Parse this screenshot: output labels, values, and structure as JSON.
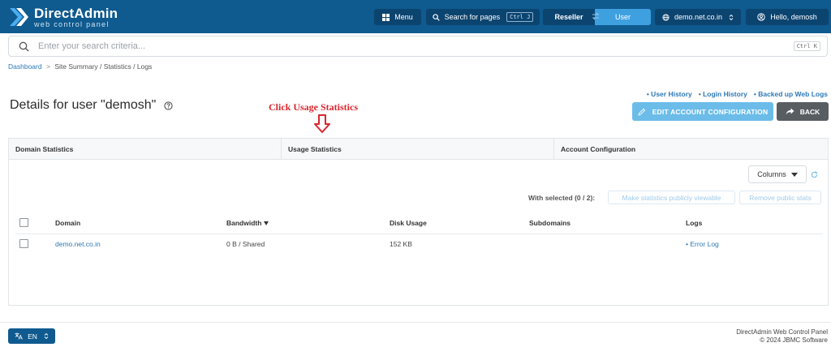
{
  "header": {
    "logo_title": "DirectAdmin",
    "logo_subtitle": "web control panel",
    "menu_label": "Menu",
    "search_pages_label": "Search for pages",
    "search_pages_shortcut": "Ctrl J",
    "role_reseller": "Reseller",
    "role_user": "User",
    "domain_selector": "demo.net.co.in",
    "hello_label": "Hello, demosh"
  },
  "search": {
    "placeholder": "Enter your search criteria...",
    "shortcut": "Ctrl K"
  },
  "breadcrumb": {
    "home": "Dashboard",
    "separator": ">",
    "current": "Site Summary / Statistics / Logs"
  },
  "user_links": [
    "• User History",
    "• Login History",
    "• Backed up Web Logs"
  ],
  "page_title": "Details for user \"demosh\"",
  "annotation": {
    "text": "Click Usage Statistics",
    "color": "#d9262e"
  },
  "actions": {
    "edit_label": "EDIT ACCOUNT CONFIGURATION",
    "back_label": "BACK"
  },
  "tabs": [
    "Domain Statistics",
    "Usage Statistics",
    "Account Configuration"
  ],
  "table_tools": {
    "columns_label": "Columns",
    "with_selected": "With selected (0 / 2):",
    "make_public_label": "Make statistics publicly viewable",
    "remove_public_label": "Remove public stats"
  },
  "table": {
    "headers": [
      "Domain",
      "Bandwidth",
      "Disk Usage",
      "Subdomains",
      "Logs"
    ],
    "rows": [
      {
        "domain": "demo.net.co.in",
        "bandwidth": "0 B / Shared",
        "disk_usage": "152 KB",
        "subdomains": "",
        "logs": "• Error Log"
      }
    ]
  },
  "footer": {
    "lang_label": "EN",
    "product": "DirectAdmin Web Control Panel",
    "copyright": "© 2024 JBMC Software"
  },
  "colors": {
    "header_bg": "#0f5a8f",
    "accent": "#3fa0e0",
    "link": "#2d79b6"
  }
}
